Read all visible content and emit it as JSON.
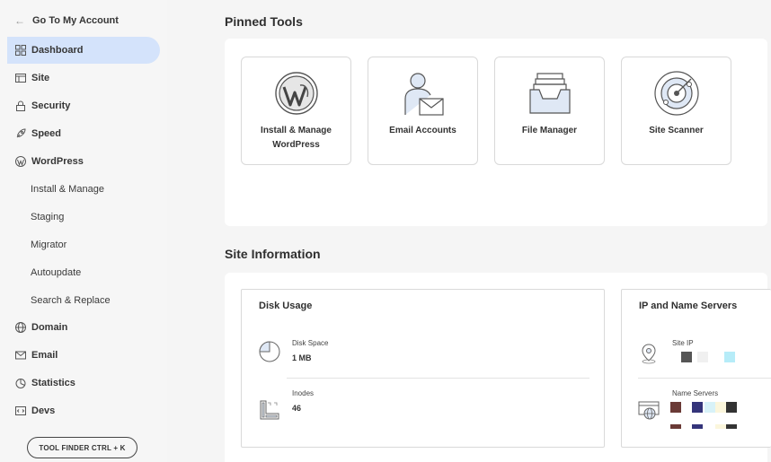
{
  "sidebar": {
    "back_label": "Go To My Account",
    "items": [
      {
        "label": "Dashboard",
        "icon": "dashboard-icon"
      },
      {
        "label": "Site",
        "icon": "site-icon"
      },
      {
        "label": "Security",
        "icon": "lock-icon"
      },
      {
        "label": "Speed",
        "icon": "rocket-icon"
      },
      {
        "label": "WordPress",
        "icon": "wordpress-icon"
      },
      {
        "label": "Install & Manage"
      },
      {
        "label": "Staging"
      },
      {
        "label": "Migrator"
      },
      {
        "label": "Autoupdate"
      },
      {
        "label": "Search & Replace"
      },
      {
        "label": "Domain",
        "icon": "globe-icon"
      },
      {
        "label": "Email",
        "icon": "envelope-icon"
      },
      {
        "label": "Statistics",
        "icon": "pie-chart-icon"
      },
      {
        "label": "Devs",
        "icon": "code-icon"
      }
    ],
    "tool_finder_label": "TOOL FINDER CTRL + K"
  },
  "pinned": {
    "title": "Pinned Tools",
    "tools": [
      {
        "label": "Install & Manage WordPress",
        "icon": "wordpress-logo-icon"
      },
      {
        "label": "Email Accounts",
        "icon": "email-accounts-icon"
      },
      {
        "label": "File Manager",
        "icon": "file-tray-icon"
      },
      {
        "label": "Site Scanner",
        "icon": "radar-icon"
      }
    ]
  },
  "site_info": {
    "title": "Site Information",
    "disk_usage": {
      "title": "Disk Usage",
      "disk_space_label": "Disk Space",
      "disk_space_value": "1 MB",
      "inodes_label": "Inodes",
      "inodes_value": "46"
    },
    "ip_ns": {
      "title": "IP and Name Servers",
      "site_ip_label": "Site IP",
      "name_servers_label": "Name Servers"
    }
  },
  "colors": {
    "active_nav": "#d4e3fb",
    "icon_blue_fill": "#dfe8f5",
    "icon_stroke": "#5a5a5a"
  }
}
